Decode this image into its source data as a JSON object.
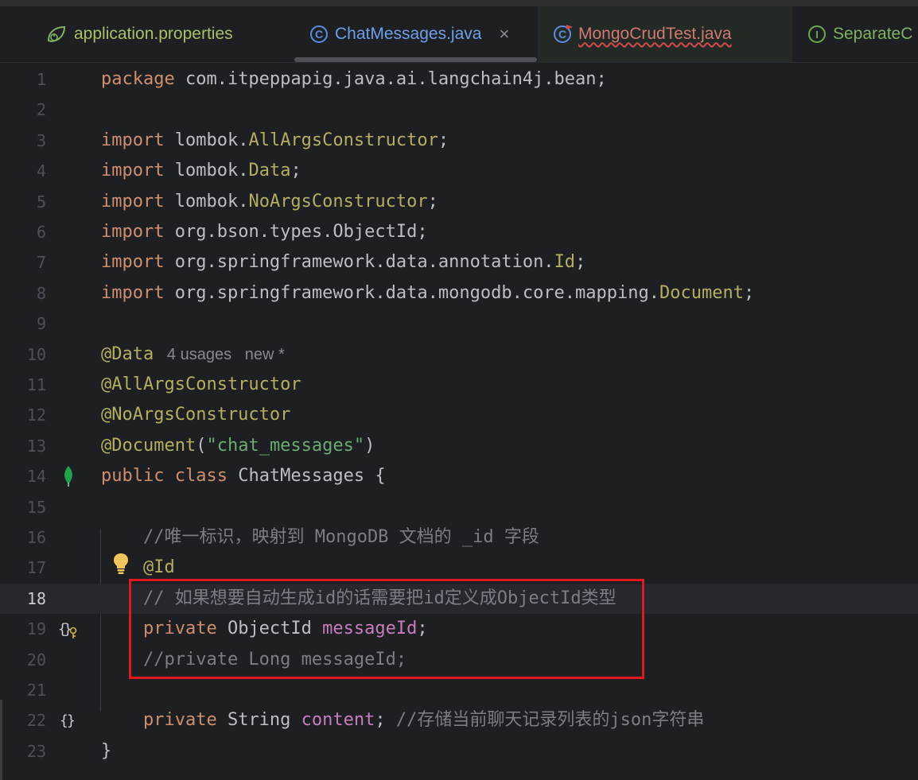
{
  "tabs": [
    {
      "label": "application.properties",
      "icon": "spring-leaf-icon",
      "active": false
    },
    {
      "label": "ChatMessages.java",
      "icon": "class-icon",
      "active": true,
      "close": "×"
    },
    {
      "label": "MongoCrudTest.java",
      "icon": "test-class-icon",
      "active": false,
      "error": true
    },
    {
      "label": "SeparateC",
      "icon": "interface-icon",
      "active": false
    }
  ],
  "editor": {
    "current_line": 18,
    "lines": [
      {
        "n": "1"
      },
      {
        "n": "2"
      },
      {
        "n": "3"
      },
      {
        "n": "4"
      },
      {
        "n": "5"
      },
      {
        "n": "6"
      },
      {
        "n": "7"
      },
      {
        "n": "8"
      },
      {
        "n": "9"
      },
      {
        "n": "10"
      },
      {
        "n": "11"
      },
      {
        "n": "12"
      },
      {
        "n": "13"
      },
      {
        "n": "14"
      },
      {
        "n": "15"
      },
      {
        "n": "16"
      },
      {
        "n": "17"
      },
      {
        "n": "18"
      },
      {
        "n": "19"
      },
      {
        "n": "20"
      },
      {
        "n": "21"
      },
      {
        "n": "22"
      },
      {
        "n": "23"
      }
    ],
    "tokens": {
      "l1_kw": "package",
      "l1_rest": " com.itpeppapig.java.ai.langchain4j.bean;",
      "import": "import",
      "l3_pkg": " lombok.",
      "l3_cls": "AllArgsConstructor",
      "semi": ";",
      "l4_pkg": " lombok.",
      "l4_cls": "Data",
      "l5_pkg": " lombok.",
      "l5_cls": "NoArgsConstructor",
      "l6_rest": " org.bson.types.ObjectId;",
      "l7_pkg": " org.springframework.data.annotation.",
      "l7_cls": "Id",
      "l8_pkg": " org.springframework.data.mongodb.core.mapping.",
      "l8_cls": "Document",
      "l10_ann": "@Data",
      "l10_hint1": "4 usages",
      "l10_hint2": "new *",
      "l11_ann": "@AllArgsConstructor",
      "l12_ann": "@NoArgsConstructor",
      "l13_ann": "@Document",
      "l13_open": "(",
      "l13_str": "\"chat_messages\"",
      "l13_close": ")",
      "l14_kw": "public class",
      "l14_rest": " ChatMessages {",
      "l16_cmt": "    //唯一标识，映射到 MongoDB 文档的 _id 字段",
      "l17_ann": "@Id",
      "l18_cmt": "    // 如果想要自动生成id的话需要把id定义成ObjectId类型",
      "l19_kw": "private",
      "l19_type": " ObjectId ",
      "l19_fld": "messageId",
      "l20_cmt": "    //private Long messageId;",
      "l22_kw": "private",
      "l22_type": " String ",
      "l22_fld": "content",
      "l22_cmt": "//存储当前聊天记录列表的json字符串",
      "l23": "}"
    }
  },
  "gutter_icons": {
    "line14": "mongodb-leaf-icon",
    "line17": "lightbulb-icon",
    "line19": "braces-key-icon",
    "line22": "braces-icon"
  },
  "colors": {
    "background": "#1e1f22",
    "keyword": "#cf8e6d",
    "annotation": "#b3ae60",
    "string": "#6aab73",
    "field": "#c77dbb",
    "comment": "#7a7e85",
    "highlight_box": "#e0191e"
  }
}
